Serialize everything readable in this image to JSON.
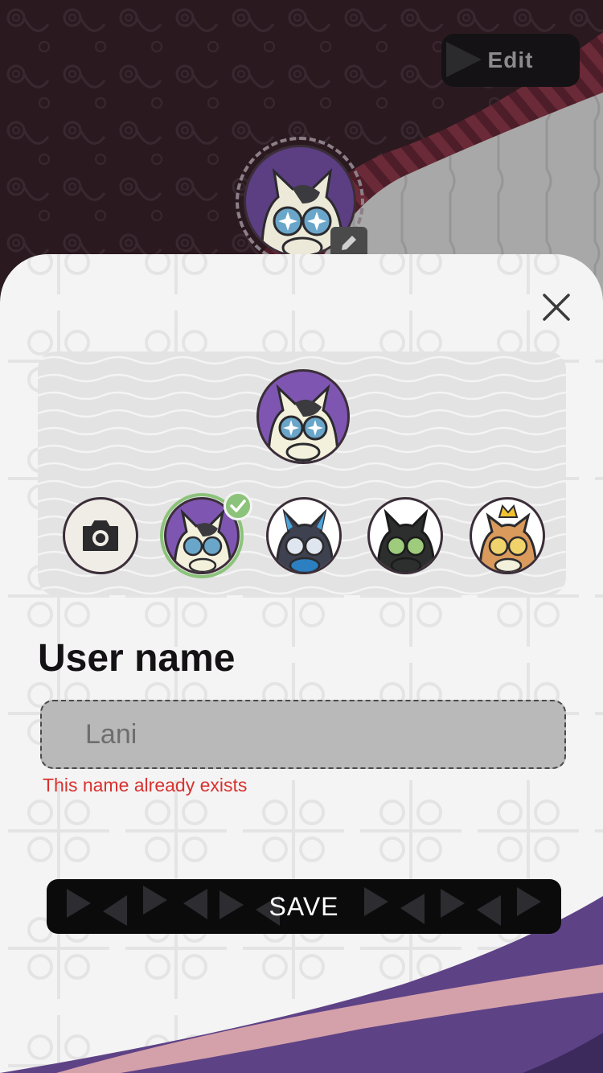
{
  "header": {
    "edit_label": "Edit",
    "avatar_icon": "cat-avatar-purple",
    "edit_avatar_icon": "pencil-icon"
  },
  "sheet": {
    "close_icon": "close-icon",
    "avatar_picker": {
      "preview_icon": "cat-avatar-purple",
      "camera_icon": "camera-icon",
      "options": [
        {
          "name": "cat-avatar-purple",
          "selected": true
        },
        {
          "name": "cat-avatar-blue",
          "selected": false
        },
        {
          "name": "cat-avatar-black",
          "selected": false
        },
        {
          "name": "cat-avatar-crowned",
          "selected": false
        }
      ]
    },
    "username": {
      "heading": "User name",
      "value": "Lani",
      "error": "This name already exists"
    },
    "save_label": "SAVE"
  },
  "colors": {
    "header_dark": "#2a1a20",
    "header_grey": "#a5a5a5",
    "sheet_bg": "#f4f4f4",
    "accent_purple": "#5e4286",
    "accent_pink": "#d4a1aa",
    "selected_green": "#8cc37a",
    "error_red": "#d8322f"
  }
}
